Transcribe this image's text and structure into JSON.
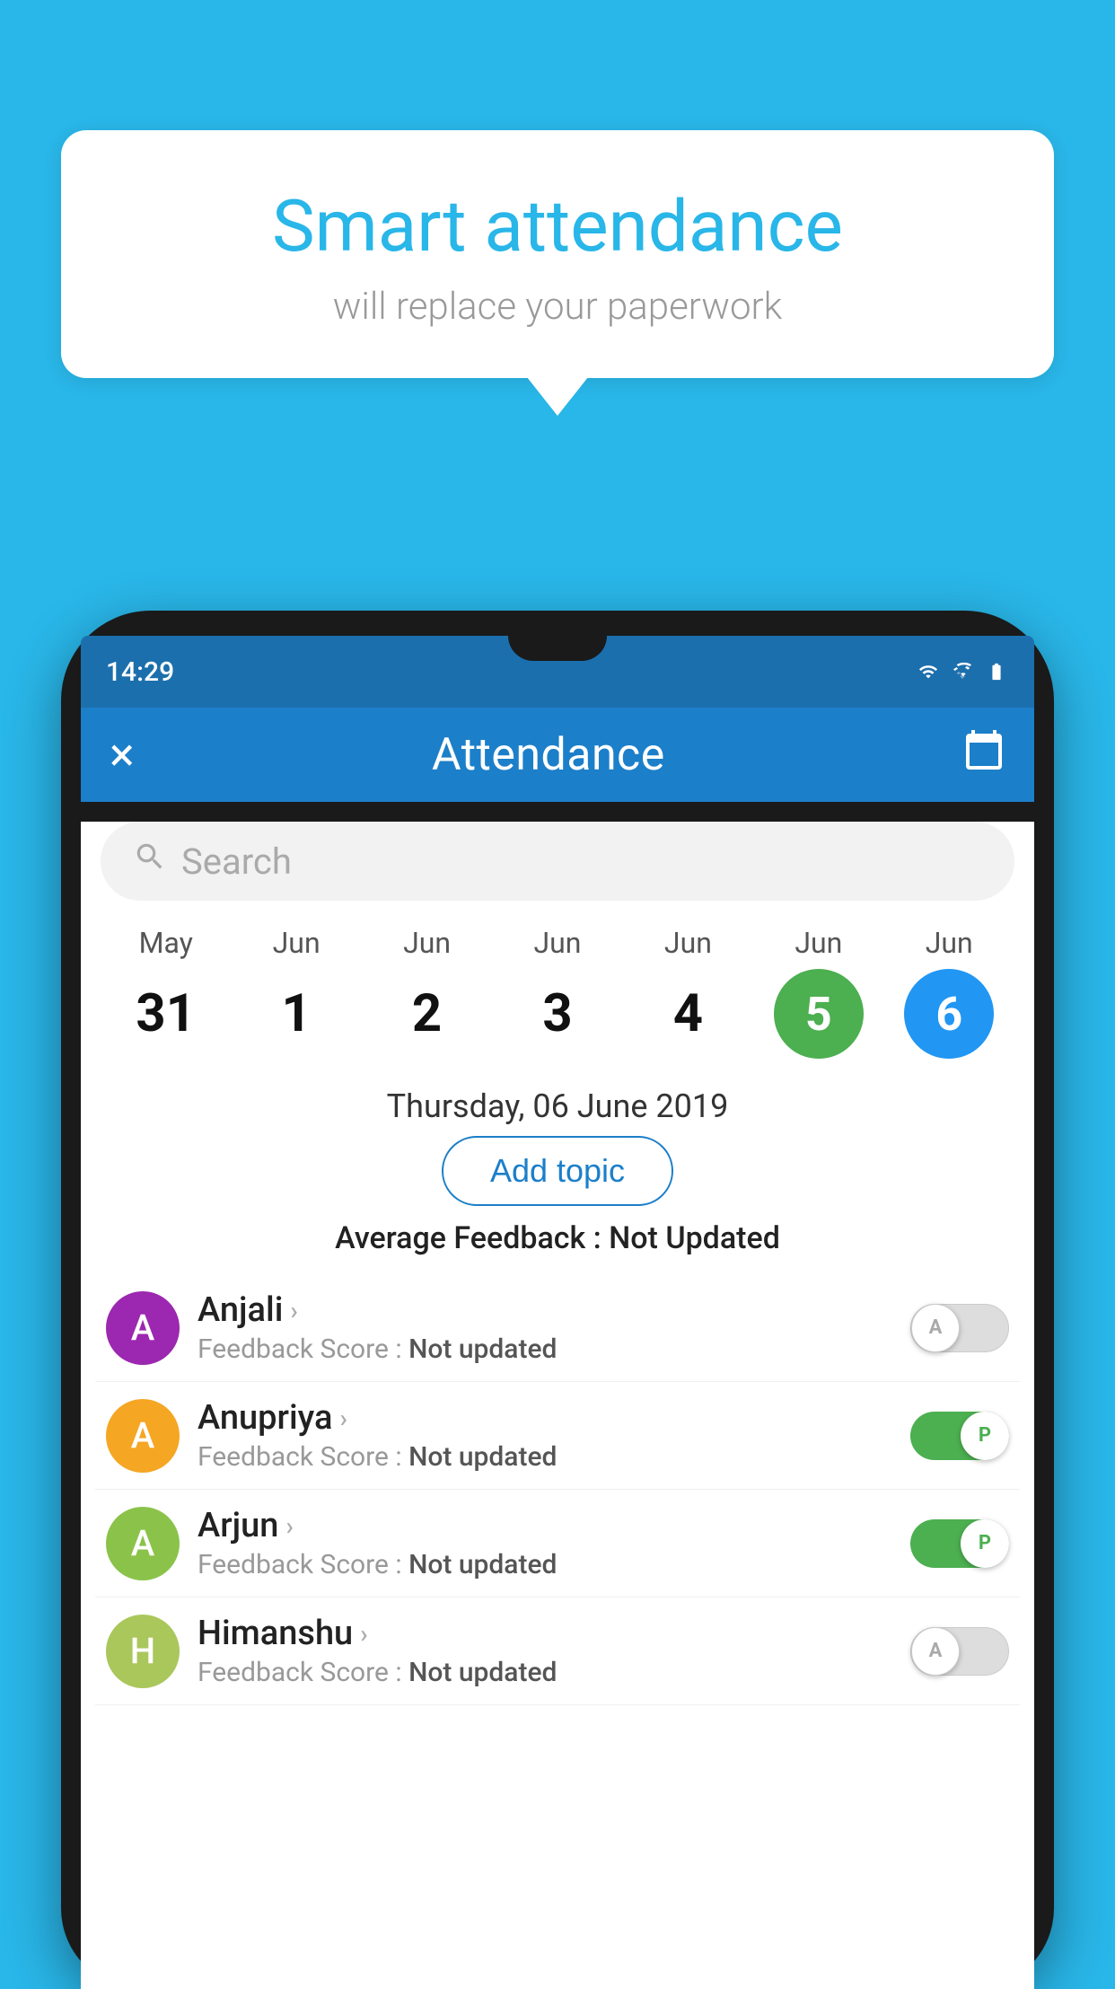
{
  "background_color": "#29b6e8",
  "bubble": {
    "title": "Smart attendance",
    "subtitle": "will replace your paperwork"
  },
  "status_bar": {
    "time": "14:29"
  },
  "header": {
    "title": "Attendance",
    "close_label": "×"
  },
  "search": {
    "placeholder": "Search"
  },
  "calendar": {
    "days": [
      {
        "month": "May",
        "date": "31",
        "state": "normal"
      },
      {
        "month": "Jun",
        "date": "1",
        "state": "normal"
      },
      {
        "month": "Jun",
        "date": "2",
        "state": "normal"
      },
      {
        "month": "Jun",
        "date": "3",
        "state": "normal"
      },
      {
        "month": "Jun",
        "date": "4",
        "state": "normal"
      },
      {
        "month": "Jun",
        "date": "5",
        "state": "today"
      },
      {
        "month": "Jun",
        "date": "6",
        "state": "selected"
      }
    ],
    "selected_date_label": "Thursday, 06 June 2019"
  },
  "add_topic_button": "Add topic",
  "average_feedback": {
    "label": "Average Feedback : ",
    "value": "Not Updated"
  },
  "students": [
    {
      "name": "Anjali",
      "initials": "A",
      "avatar_color": "#9c27b0",
      "feedback_label": "Feedback Score : ",
      "feedback_value": "Not updated",
      "toggle_state": "off",
      "toggle_letter": "A"
    },
    {
      "name": "Anupriya",
      "initials": "A",
      "avatar_color": "#f5a623",
      "feedback_label": "Feedback Score : ",
      "feedback_value": "Not updated",
      "toggle_state": "on",
      "toggle_letter": "P"
    },
    {
      "name": "Arjun",
      "initials": "A",
      "avatar_color": "#8bc34a",
      "feedback_label": "Feedback Score : ",
      "feedback_value": "Not updated",
      "toggle_state": "on",
      "toggle_letter": "P"
    },
    {
      "name": "Himanshu",
      "initials": "H",
      "avatar_color": "#aac75c",
      "feedback_label": "Feedback Score : ",
      "feedback_value": "Not updated",
      "toggle_state": "off",
      "toggle_letter": "A"
    }
  ]
}
